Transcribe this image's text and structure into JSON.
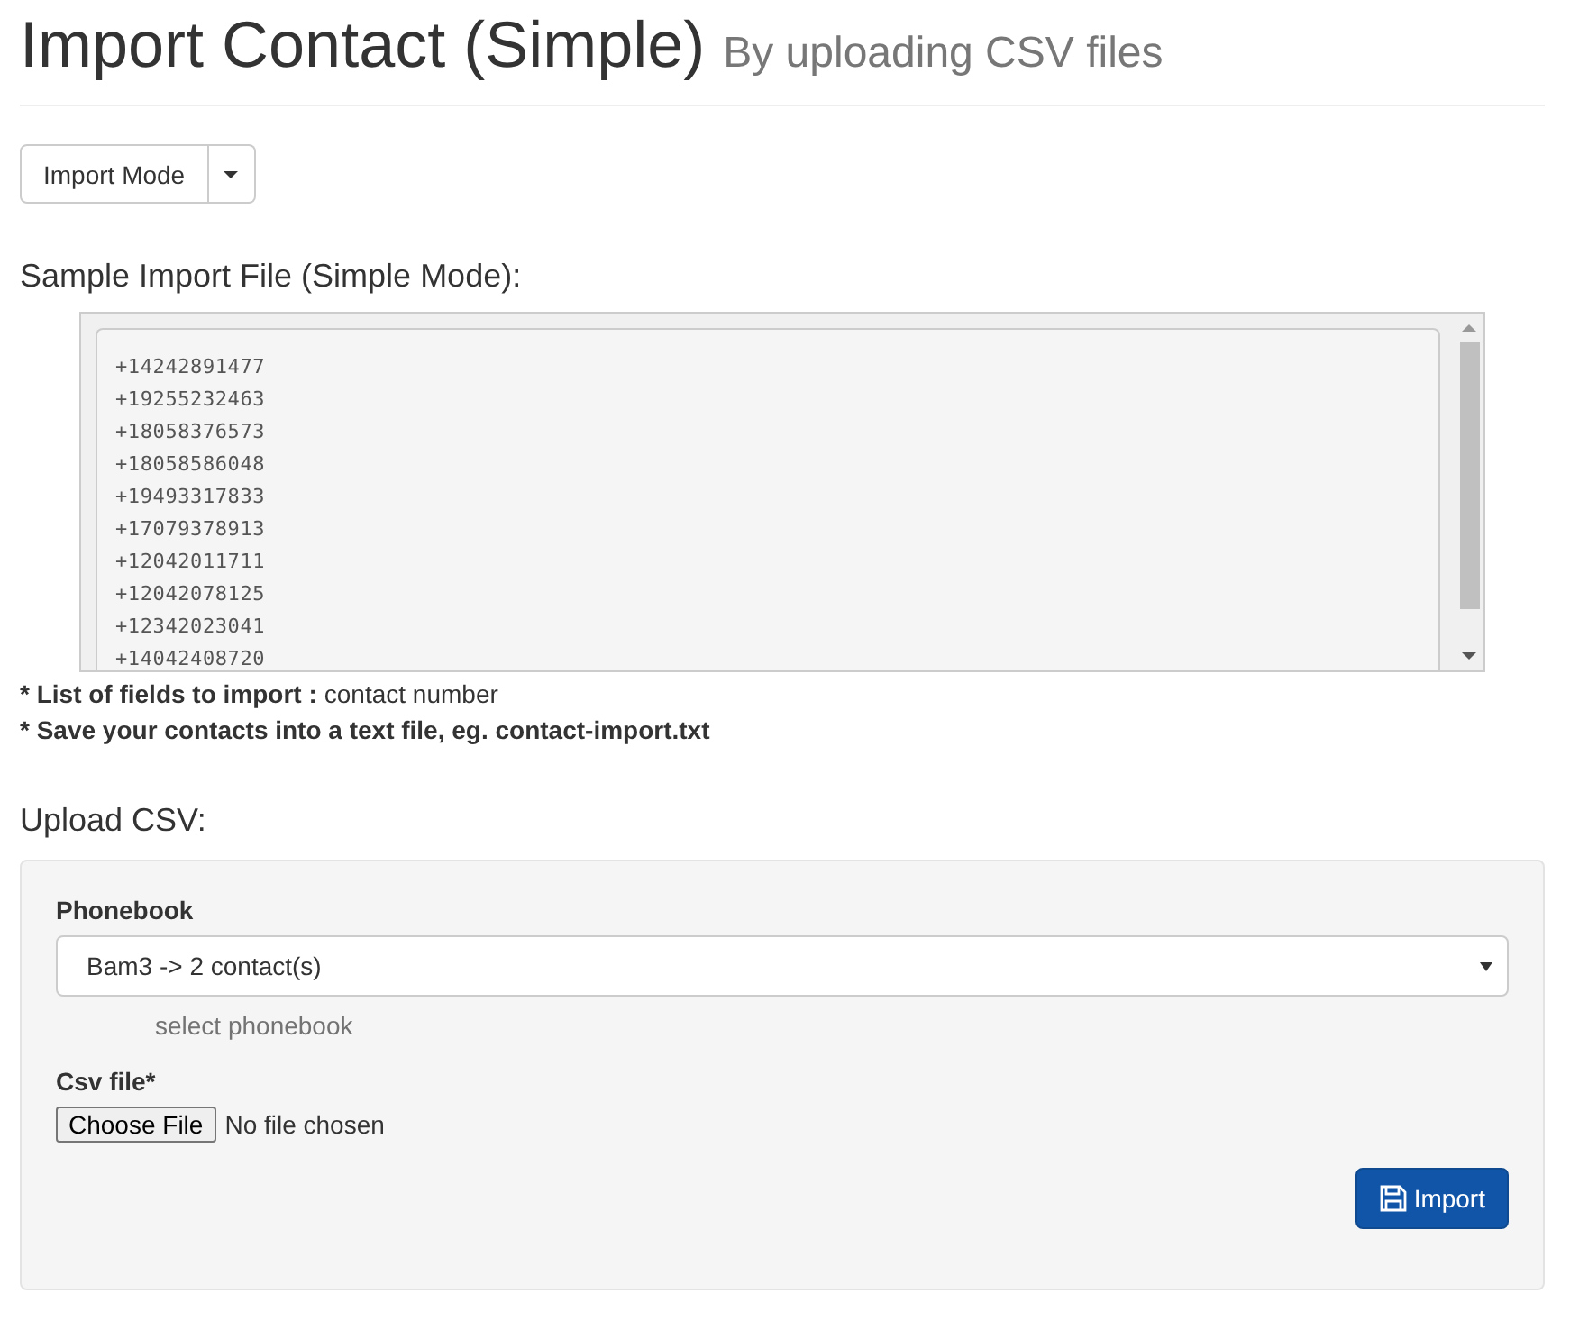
{
  "header": {
    "title": "Import Contact (Simple)",
    "subtitle": "By uploading CSV files"
  },
  "mode_button": {
    "label": "Import Mode"
  },
  "sample": {
    "heading": "Sample Import File (Simple Mode):",
    "lines": [
      "+14242891477",
      "+19255232463",
      "+18058376573",
      "+18058586048",
      "+19493317833",
      "+17079378913",
      "+12042011711",
      "+12042078125",
      "+12342023041",
      "+14042408720"
    ]
  },
  "notes": [
    {
      "label": "* List of fields to import :",
      "value": "contact number"
    },
    {
      "label": "* Save your contacts into a text file, eg. contact-import.txt"
    }
  ],
  "upload": {
    "heading": "Upload CSV:",
    "phonebook_label": "Phonebook",
    "phonebook_value": "Bam3 -> 2 contact(s)",
    "phonebook_help": "select phonebook",
    "file_label": "Csv file*",
    "file_button": "Choose File",
    "file_status": "No file chosen",
    "submit": "Import"
  }
}
